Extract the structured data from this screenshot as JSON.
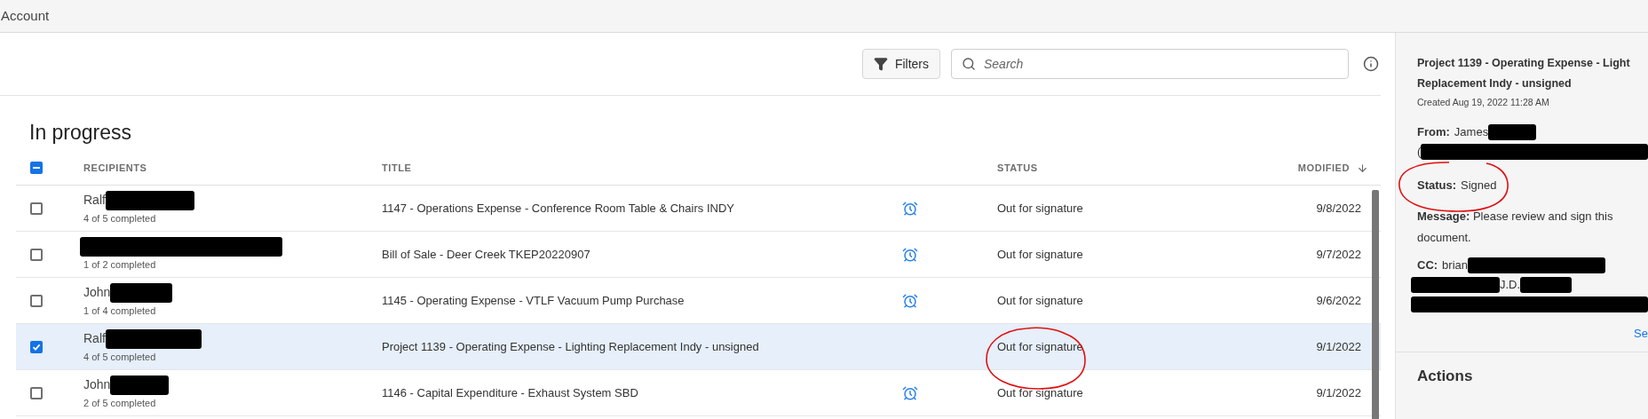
{
  "top_bar": {
    "title": "Account"
  },
  "toolbar": {
    "filters_button": "Filters",
    "search": {
      "placeholder": "Search"
    }
  },
  "section_title": "In progress",
  "table": {
    "select_all": {
      "indeterminate": true
    },
    "columns": [
      {
        "label": "RECIPIENTS",
        "sorted": false
      },
      {
        "label": "TITLE",
        "sorted": false
      },
      {
        "label": "STATUS",
        "sorted": false
      },
      {
        "label": "MODIFIED",
        "sorted": true
      }
    ],
    "rows": [
      {
        "recipient": "Ralf",
        "progress": "4 of 5 completed",
        "title": "1147 - Operations Expense - Conference Room Table & Chairs INDY",
        "reminder": true,
        "status": "Out for signature",
        "modified": "9/8/2022",
        "selected": false
      },
      {
        "progress": "1 of 2 completed",
        "title": "Bill of Sale - Deer Creek TKEP20220907",
        "reminder": true,
        "status": "Out for signature",
        "modified": "9/7/2022",
        "selected": false
      },
      {
        "recipient": "John",
        "progress": "1 of 4 completed",
        "title": "1145 - Operating Expense - VTLF Vacuum Pump Purchase",
        "reminder": true,
        "status": "Out for signature",
        "modified": "9/6/2022",
        "selected": false
      },
      {
        "recipient": "Ralf",
        "progress": "4 of 5 completed",
        "title": "Project 1139 - Operating Expense - Lighting Replacement Indy - unsigned",
        "reminder": false,
        "status": "Out for signature",
        "modified": "9/1/2022",
        "selected": true
      },
      {
        "recipient": "John",
        "progress": "2 of 5 completed",
        "title": "1146 - Capital Expenditure - Exhaust System SBD",
        "reminder": true,
        "status": "Out for signature",
        "modified": "9/1/2022",
        "selected": false
      }
    ]
  },
  "details": {
    "title_lines": [
      "Project 1139 - Operating Expense - Light",
      "Replacement Indy - unsigned"
    ],
    "created": "Created Aug 19, 2022 11:28 AM",
    "from": {
      "label": "From:",
      "value": "James",
      "second_line": "("
    },
    "status": {
      "label": "Status:",
      "value": "Signed"
    },
    "message": {
      "label": "Message:",
      "value": "Please review and sign this document."
    },
    "cc": {
      "label": "CC:",
      "value": "brian",
      "second_line": "J.D."
    },
    "link": "Se",
    "actions_title": "Actions"
  }
}
